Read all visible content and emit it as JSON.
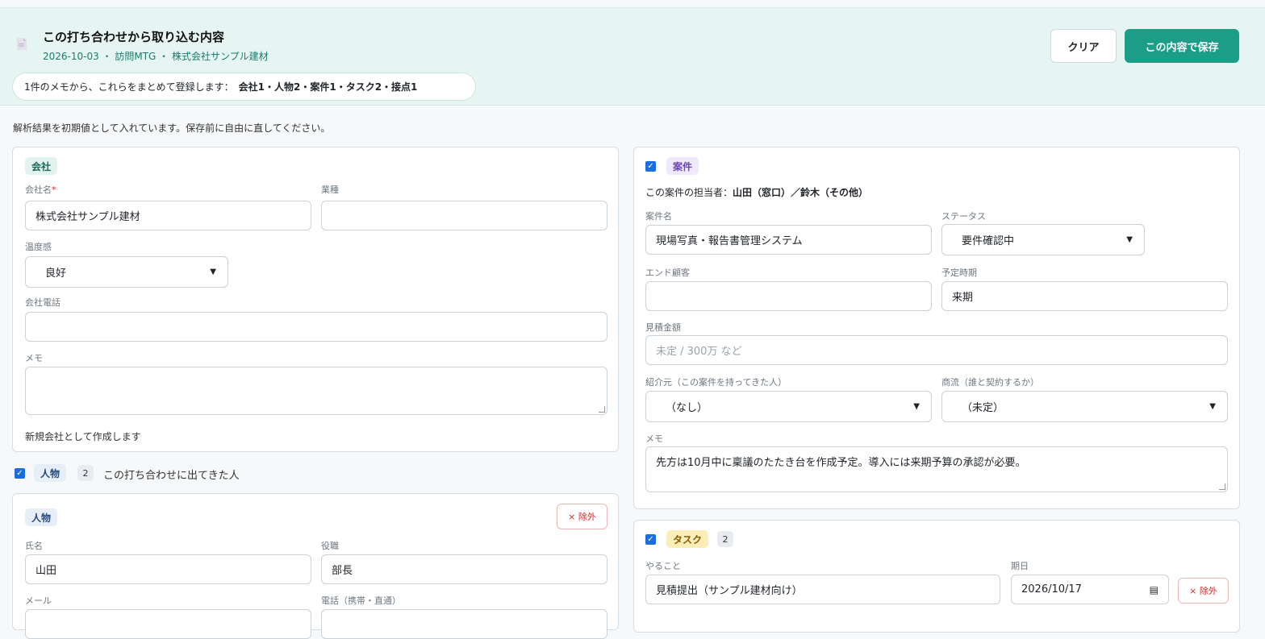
{
  "header": {
    "title": "この打ち合わせから取り込む内容",
    "subtitle": "2026-10-03 ・ 訪問MTG ・ 株式会社サンプル建材",
    "summary_prefix": "1件のメモから、これらをまとめて登録します：",
    "summary_items": "会社1・人物2・案件1・タスク2・接点1",
    "clear_label": "クリア",
    "save_label": "この内容で保存"
  },
  "notice": "解析結果を初期値として入れています。保存前に自由に直してください。",
  "company": {
    "tag": "会社",
    "name_label": "会社名",
    "required_mark": "*",
    "name_value": "株式会社サンプル建材",
    "industry_label": "業種",
    "industry_value": "",
    "temperature_label": "温度感",
    "temperature_value": "良好",
    "phone_label": "会社電話",
    "phone_value": "",
    "memo_label": "メモ",
    "memo_value": "",
    "note": "新規会社として作成します"
  },
  "people_section": {
    "tag": "人物",
    "count": "2",
    "caption": "この打ち合わせに出てきた人"
  },
  "person": {
    "tag": "人物",
    "remove_label": "× 除外",
    "name_label": "氏名",
    "name_value": "山田",
    "title_label": "役職",
    "title_value": "部長",
    "email_label": "メール",
    "phone_label": "電話（携帯・直通）"
  },
  "deal": {
    "tag": "案件",
    "owner_prefix": "この案件の担当者：",
    "owner_value": "山田（窓口）／鈴木（その他）",
    "name_label": "案件名",
    "name_value": "現場写真・報告書管理システム",
    "status_label": "ステータス",
    "status_value": "要件確認中",
    "end_customer_label": "エンド顧客",
    "end_customer_value": "",
    "schedule_label": "予定時期",
    "schedule_value": "来期",
    "estimate_label": "見積金額",
    "estimate_placeholder": "未定 / 300万 など",
    "referrer_label": "紹介元（この案件を持ってきた人）",
    "referrer_value": "（なし）",
    "channel_label": "商流（誰と契約するか）",
    "channel_value": "（未定）",
    "memo_label": "メモ",
    "memo_value": "先方は10月中に稟議のたたき台を作成予定。導入には来期予算の承認が必要。"
  },
  "tasks": {
    "tag": "タスク",
    "count": "2",
    "todo_label": "やること",
    "todo_value": "見積提出（サンプル建材向け）",
    "due_label": "期日",
    "due_value": "2026/10/17",
    "remove_label": "× 除外"
  },
  "icons": {
    "doc": "document-icon",
    "check": "checkbox-checked-icon",
    "chevron": "chevron-down-icon",
    "calendar": "calendar-icon"
  },
  "colors": {
    "accent": "#1b9d87",
    "header_bg": "#e6f5f2",
    "checkbox": "#1a6fe0",
    "danger": "#cf2a2a"
  }
}
